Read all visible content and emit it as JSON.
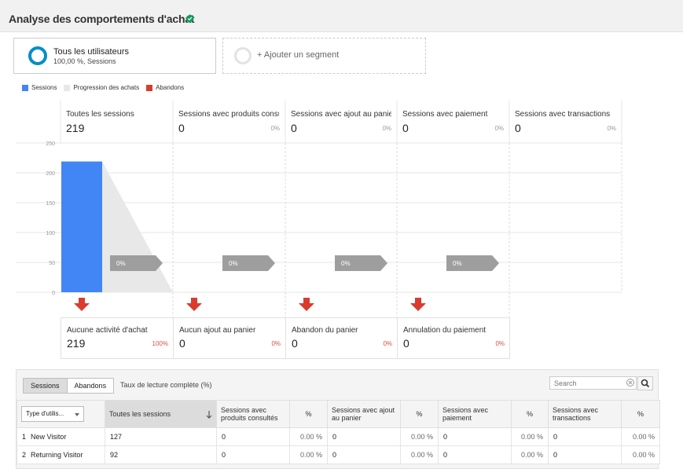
{
  "header": {
    "title": "Analyse des comportements d'achat"
  },
  "segment": {
    "name": "Tous les utilisateurs",
    "stat": "100,00 %, Sessions",
    "add_label": "+ Ajouter un segment"
  },
  "legend": [
    {
      "label": "Sessions",
      "color": "#4285f4"
    },
    {
      "label": "Progression des achats",
      "color": "#e8e8e8"
    },
    {
      "label": "Abandons",
      "color": "#d93c2f"
    }
  ],
  "stages": [
    {
      "title": "Toutes les sessions",
      "count": "219",
      "pct": ""
    },
    {
      "title": "Sessions avec produits consultés",
      "count": "0",
      "pct": "0%"
    },
    {
      "title": "Sessions avec ajout au panier",
      "count": "0",
      "pct": "0%"
    },
    {
      "title": "Sessions avec paiement",
      "count": "0",
      "pct": "0%"
    },
    {
      "title": "Sessions avec transactions",
      "count": "0",
      "pct": "0%"
    }
  ],
  "conversion_arrows": [
    "0%",
    "0%",
    "0%",
    "0%"
  ],
  "drop_offs": [
    {
      "title": "Aucune activité d'achat",
      "count": "219",
      "pct": "100%"
    },
    {
      "title": "Aucun ajout au panier",
      "count": "0",
      "pct": "0%"
    },
    {
      "title": "Abandon du panier",
      "count": "0",
      "pct": "0%"
    },
    {
      "title": "Annulation du paiement",
      "count": "0",
      "pct": "0%"
    }
  ],
  "chart_data": {
    "type": "bar",
    "categories": [
      "Toutes les sessions",
      "Sessions avec produits consultés",
      "Sessions avec ajout au panier",
      "Sessions avec paiement",
      "Sessions avec transactions"
    ],
    "values": [
      219,
      0,
      0,
      0,
      0
    ],
    "ylim": [
      0,
      250
    ],
    "yticks": [
      0,
      50,
      100,
      150,
      200,
      250
    ],
    "grid": true
  },
  "table": {
    "tabs": [
      "Sessions",
      "Abandons"
    ],
    "metric_link": "Taux de lecture complète (%)",
    "search_placeholder": "Search",
    "dimension": "Type d'utilis...",
    "columns": [
      "Toutes les sessions",
      "Sessions avec produits consultés",
      "%",
      "Sessions avec ajout au panier",
      "%",
      "Sessions avec paiement",
      "%",
      "Sessions avec transactions",
      "%"
    ],
    "rows": [
      {
        "index": "1",
        "label": "New Visitor",
        "values": [
          "127",
          "0",
          "0.00 %",
          "0",
          "0.00 %",
          "0",
          "0.00 %",
          "0",
          "0.00 %"
        ]
      },
      {
        "index": "2",
        "label": "Returning Visitor",
        "values": [
          "92",
          "0",
          "0.00 %",
          "0",
          "0.00 %",
          "0",
          "0.00 %",
          "0",
          "0.00 %"
        ]
      }
    ]
  }
}
